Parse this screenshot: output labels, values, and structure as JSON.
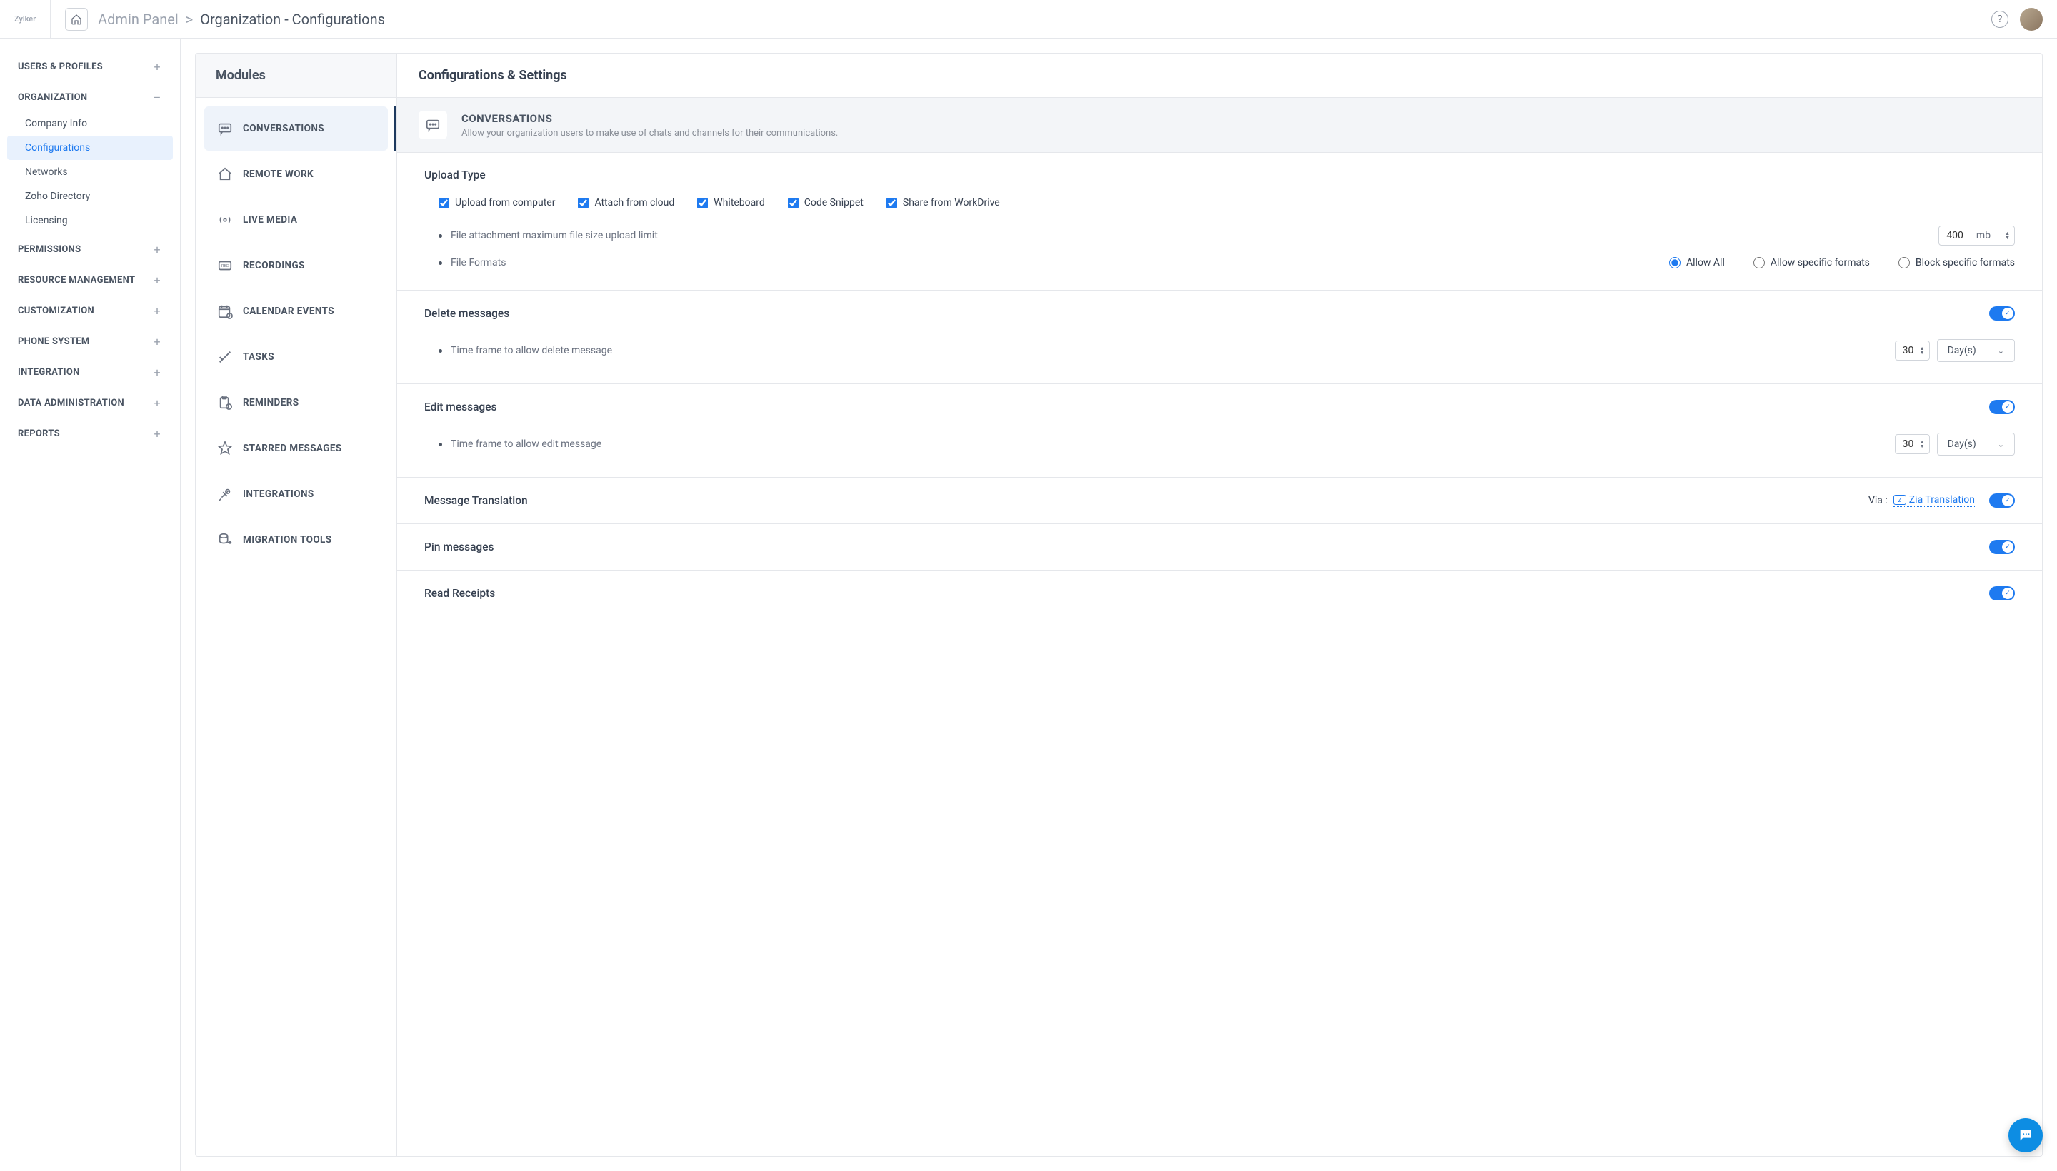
{
  "topbar": {
    "logo": "Zylker",
    "breadcrumb_root": "Admin Panel",
    "breadcrumb_sep": ">",
    "breadcrumb_current": "Organization - Configurations"
  },
  "sidebar": {
    "sections": [
      {
        "title": "USERS & PROFILES",
        "collapsed": true
      },
      {
        "title": "ORGANIZATION",
        "collapsed": false,
        "open_glyph": "–",
        "items": [
          "Company Info",
          "Configurations",
          "Networks",
          "Zoho Directory",
          "Licensing"
        ],
        "activeIndex": 1
      },
      {
        "title": "PERMISSIONS",
        "collapsed": true
      },
      {
        "title": "RESOURCE MANAGEMENT",
        "collapsed": true
      },
      {
        "title": "CUSTOMIZATION",
        "collapsed": true
      },
      {
        "title": "PHONE SYSTEM",
        "collapsed": true
      },
      {
        "title": "INTEGRATION",
        "collapsed": true
      },
      {
        "title": "DATA ADMINISTRATION",
        "collapsed": true
      },
      {
        "title": "REPORTS",
        "collapsed": true
      }
    ]
  },
  "modules": {
    "title": "Modules",
    "items": [
      "CONVERSATIONS",
      "REMOTE WORK",
      "LIVE MEDIA",
      "RECORDINGS",
      "CALENDAR EVENTS",
      "TASKS",
      "REMINDERS",
      "STARRED MESSAGES",
      "INTEGRATIONS",
      "MIGRATION TOOLS"
    ],
    "activeIndex": 0
  },
  "content": {
    "title": "Configurations & Settings",
    "banner": {
      "title": "CONVERSATIONS",
      "subtitle": "Allow your organization users to make use of chats and channels for their communications."
    },
    "uploadType": {
      "title": "Upload Type",
      "checks": [
        "Upload from computer",
        "Attach from cloud",
        "Whiteboard",
        "Code Snippet",
        "Share from WorkDrive"
      ],
      "maxSizeLabel": "File attachment maximum file size upload limit",
      "maxSizeValue": "400",
      "maxSizeUnit": "mb",
      "fileFormatsLabel": "File Formats",
      "radios": [
        "Allow All",
        "Allow specific formats",
        "Block specific formats"
      ],
      "radioSelected": 0
    },
    "deleteMessages": {
      "title": "Delete messages",
      "timeframeLabel": "Time frame to allow delete message",
      "value": "30",
      "unit": "Day(s)"
    },
    "editMessages": {
      "title": "Edit messages",
      "timeframeLabel": "Time frame to allow edit message",
      "value": "30",
      "unit": "Day(s)"
    },
    "translation": {
      "title": "Message Translation",
      "via": "Via :",
      "link": "Zia Translation"
    },
    "pinMessages": {
      "title": "Pin messages"
    },
    "readReceipts": {
      "title": "Read Receipts"
    }
  }
}
